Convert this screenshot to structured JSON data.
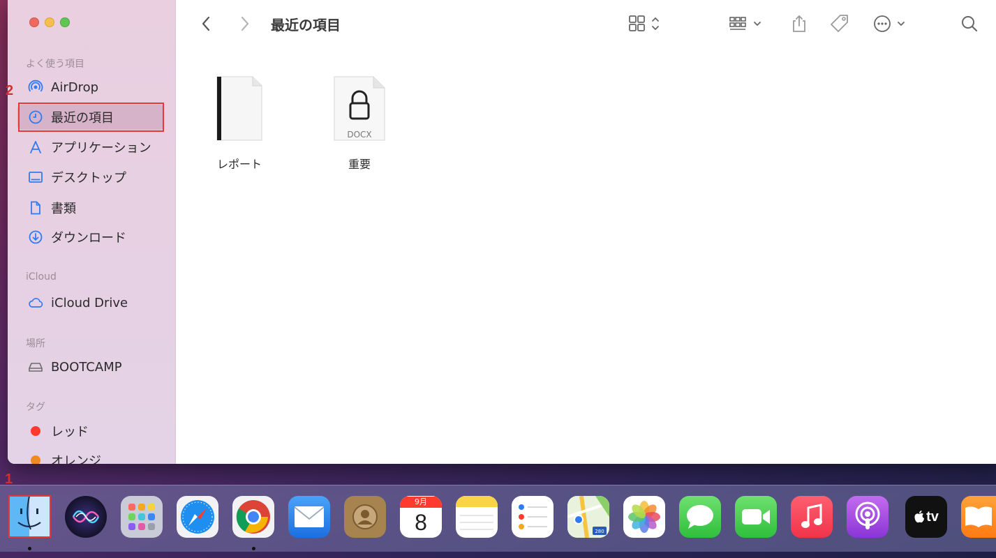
{
  "window": {
    "title": "最近の項目"
  },
  "sidebar": {
    "sections": [
      {
        "title": "よく使う項目"
      },
      {
        "title": "iCloud"
      },
      {
        "title": "場所"
      },
      {
        "title": "タグ"
      }
    ],
    "favorites": [
      {
        "label": "AirDrop",
        "icon": "airdrop-icon"
      },
      {
        "label": "最近の項目",
        "icon": "clock-icon",
        "selected": true
      },
      {
        "label": "アプリケーション",
        "icon": "applications-icon"
      },
      {
        "label": "デスクトップ",
        "icon": "desktop-icon"
      },
      {
        "label": "書類",
        "icon": "document-icon"
      },
      {
        "label": "ダウンロード",
        "icon": "download-icon"
      }
    ],
    "icloud": [
      {
        "label": "iCloud Drive",
        "icon": "cloud-icon"
      }
    ],
    "locations": [
      {
        "label": "BOOTCAMP",
        "icon": "drive-icon"
      }
    ],
    "tags": [
      {
        "label": "レッド",
        "color": "#ff3b30"
      },
      {
        "label": "オレンジ",
        "color": "#f08a24"
      }
    ]
  },
  "files": [
    {
      "name": "レポート",
      "icon": "document-file-icon"
    },
    {
      "name": "重要",
      "icon": "locked-docx-icon",
      "badge": "DOCX"
    }
  ],
  "markers": {
    "one": "1",
    "two": "2"
  },
  "dock": {
    "calendar_month": "9月",
    "calendar_day": "8",
    "apps": [
      "Finder",
      "Siri",
      "Launchpad",
      "Safari",
      "Chrome",
      "Mail",
      "Contacts",
      "Calendar",
      "Notes",
      "Reminders",
      "Maps",
      "Photos",
      "Messages",
      "FaceTime",
      "Music",
      "Podcasts",
      "TV",
      "Books"
    ],
    "tv_label": "tv",
    "maps_shield": "280"
  }
}
